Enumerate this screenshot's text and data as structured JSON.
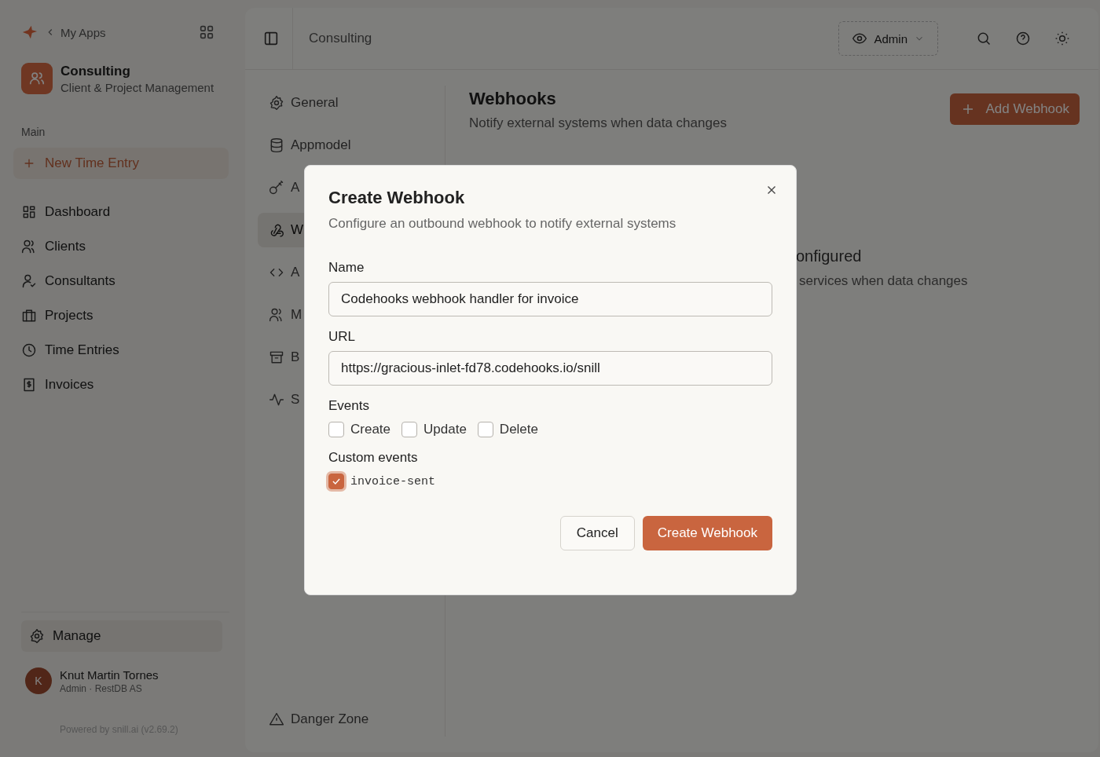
{
  "sidebar": {
    "back_label": "My Apps",
    "app": {
      "name": "Consulting",
      "subtitle": "Client & Project Management"
    },
    "section": "Main",
    "new_button": "New Time Entry",
    "items": [
      {
        "label": "Dashboard"
      },
      {
        "label": "Clients"
      },
      {
        "label": "Consultants"
      },
      {
        "label": "Projects"
      },
      {
        "label": "Time Entries"
      },
      {
        "label": "Invoices"
      }
    ],
    "manage": "Manage",
    "user": {
      "initial": "K",
      "name": "Knut Martin Tornes",
      "role": "Admin · RestDB AS"
    },
    "powered_by": "Powered by snill.ai (v2.69.2)"
  },
  "topbar": {
    "title": "Consulting",
    "role": "Admin"
  },
  "settings_nav": {
    "items": [
      {
        "label": "General",
        "selected": false
      },
      {
        "label": "Appmodel",
        "selected": false
      },
      {
        "label": "A",
        "selected": false
      },
      {
        "label": "W",
        "selected": true
      },
      {
        "label": "A",
        "selected": false
      },
      {
        "label": "M",
        "selected": false
      },
      {
        "label": "B",
        "selected": false
      },
      {
        "label": "S",
        "selected": false
      }
    ],
    "danger": "Danger Zone"
  },
  "content": {
    "title": "Webhooks",
    "subtitle": "Notify external systems when data changes",
    "add_button": "Add Webhook",
    "empty_title": "onfigured",
    "empty_text": "services when data changes"
  },
  "modal": {
    "title": "Create Webhook",
    "subtitle": "Configure an outbound webhook to notify external systems",
    "name_label": "Name",
    "name_value": "Codehooks webhook handler for invoice",
    "url_label": "URL",
    "url_value": "https://gracious-inlet-fd78.codehooks.io/snill",
    "events_label": "Events",
    "events": [
      {
        "label": "Create",
        "checked": false
      },
      {
        "label": "Update",
        "checked": false
      },
      {
        "label": "Delete",
        "checked": false
      }
    ],
    "custom_label": "Custom events",
    "custom_events": [
      {
        "label": "invoice-sent",
        "checked": true
      }
    ],
    "cancel": "Cancel",
    "submit": "Create Webhook"
  }
}
